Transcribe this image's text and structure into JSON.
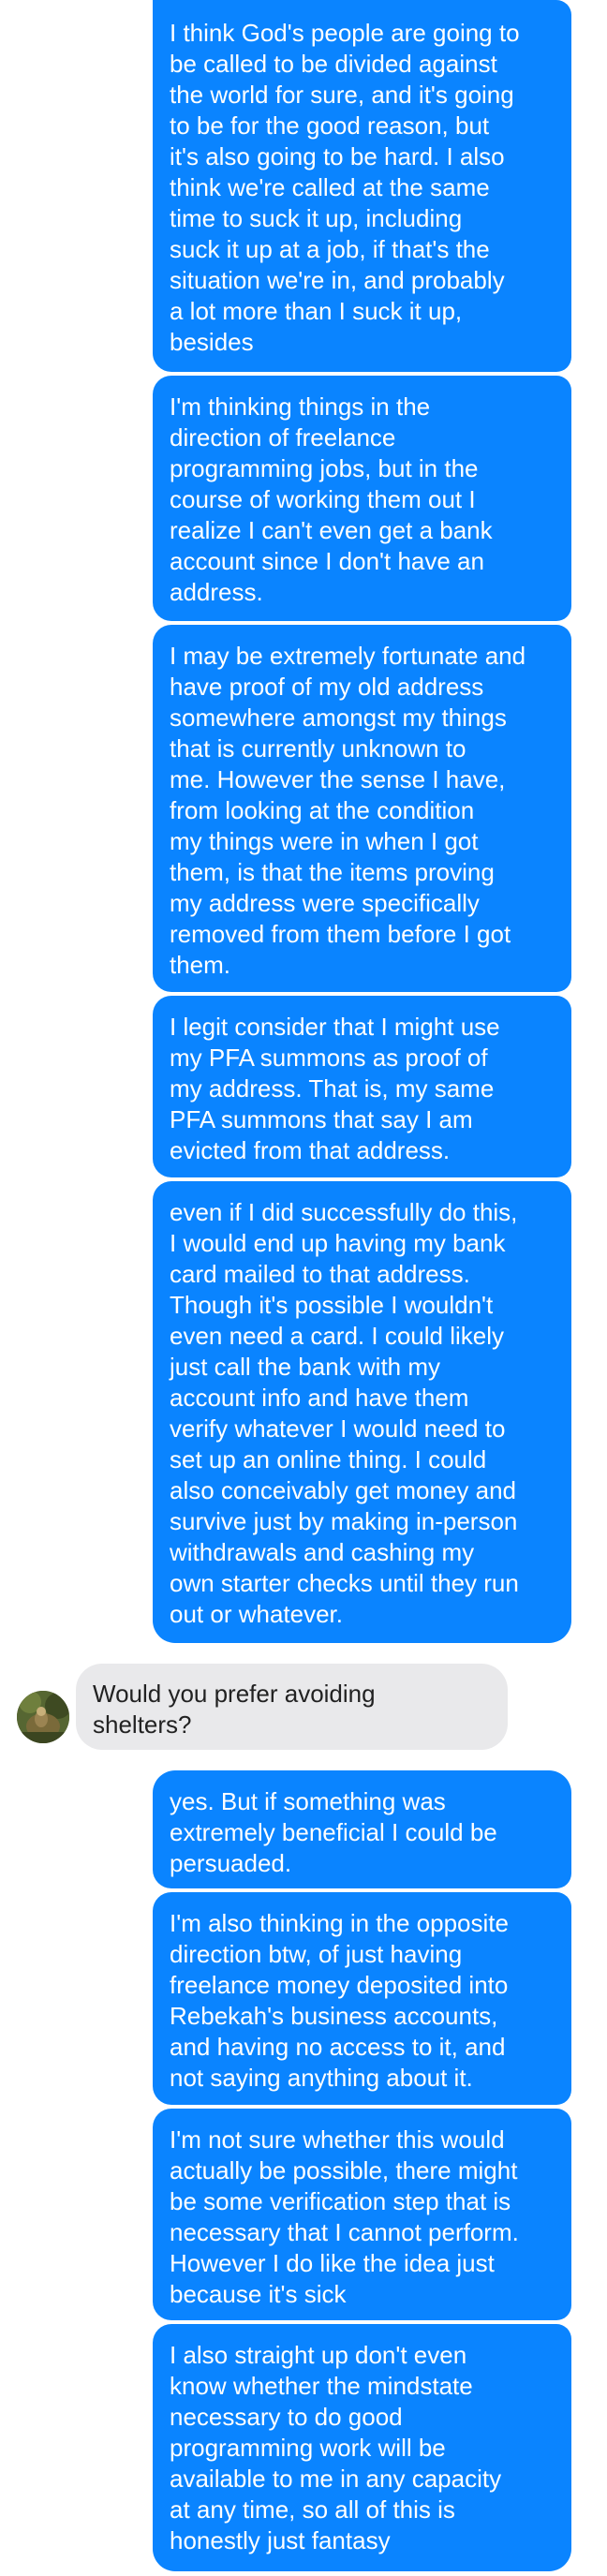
{
  "colors": {
    "outgoing_bubble": "#0a84ff",
    "outgoing_text": "#ffffff",
    "incoming_bubble": "#e9e9eb",
    "incoming_text": "#222222",
    "background": "#ffffff"
  },
  "contact": {
    "avatar_icon": "profile-photo-avatar"
  },
  "messages": [
    {
      "direction": "outgoing",
      "text": "I think God's people are going to\nbe called to be divided against\nthe world for sure, and it's going\nto be for the good reason, but\nit's also going to be hard. I also\nthink we're called at the same\ntime to suck it up, including\nsuck it up at a job, if that's the\nsituation we're in, and probably\na lot more than I suck it up,\nbesides"
    },
    {
      "direction": "outgoing",
      "text": "I'm thinking things in the\ndirection of freelance\nprogramming jobs, but in the\ncourse of working them out I\nrealize I can't even get a bank\naccount since I don't have an\naddress."
    },
    {
      "direction": "outgoing",
      "text": "I may be extremely fortunate and\nhave proof of my old address\nsomewhere amongst my things\nthat is currently unknown to\nme. However the sense I have,\nfrom looking at the condition\nmy things were in when I got\nthem, is that the items proving\nmy address were specifically\nremoved from them before I got\nthem."
    },
    {
      "direction": "outgoing",
      "text": "I legit consider that I might use\nmy PFA summons as proof of\nmy address. That is, my same\nPFA summons that say I am\nevicted from that address."
    },
    {
      "direction": "outgoing",
      "text": "even if I did successfully do this,\nI would end up having my bank\ncard mailed to that address.\nThough it's possible I wouldn't\neven need a card. I could likely\njust call the bank with my\naccount info and have them\nverify whatever I would need to\nset up an online thing. I could\nalso conceivably get money and\nsurvive just by making in-person\nwithdrawals and cashing my\nown starter checks until they run\nout or whatever."
    },
    {
      "direction": "incoming",
      "text": "Would you prefer avoiding\nshelters?"
    },
    {
      "direction": "outgoing",
      "text": "yes. But if something was\nextremely beneficial I could be\npersuaded."
    },
    {
      "direction": "outgoing",
      "text": "I'm also thinking in the opposite\ndirection btw, of just having\nfreelance money deposited into\nRebekah's business accounts,\nand having no access to it, and\nnot saying anything about it."
    },
    {
      "direction": "outgoing",
      "text": "I'm not sure whether this would\nactually be possible, there might\nbe some verification step that is\nnecessary that I cannot perform.\nHowever I do like the idea just\nbecause it's sick"
    },
    {
      "direction": "outgoing",
      "text": "I also straight up don't even\nknow whether the mindstate\nnecessary to do good\nprogramming work will be\navailable to me in any capacity\nat any time, so all of this is\nhonestly just fantasy"
    }
  ]
}
